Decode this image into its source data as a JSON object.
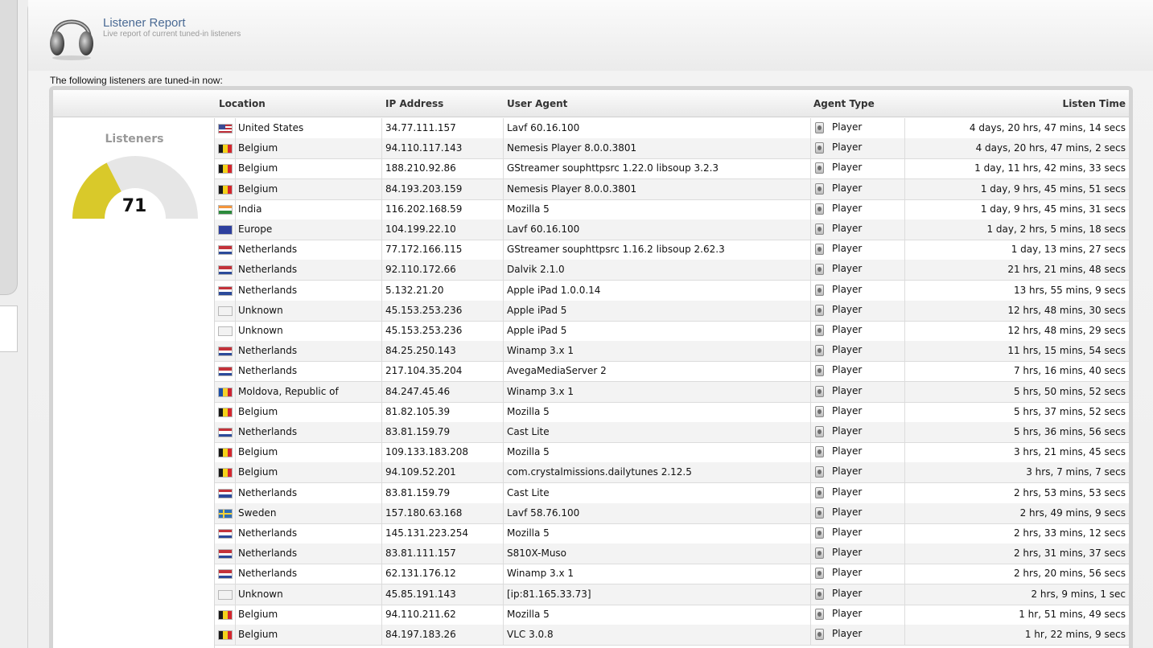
{
  "header": {
    "title": "Listener Report",
    "subtitle": "Live report of current tuned-in listeners"
  },
  "intro_text": "The following listeners are tuned-in now:",
  "table": {
    "columns": [
      "Location",
      "IP Address",
      "User Agent",
      "Agent Type",
      "Listen Time"
    ]
  },
  "summary": {
    "label": "Listeners",
    "count": "71",
    "gauge_fraction": 0.35,
    "gauge_color": "#d9c92a",
    "gauge_track_color": "#e6e6e6"
  },
  "listeners": [
    {
      "location": "United States",
      "flag": "us",
      "ip": "34.77.111.157",
      "agent": "Lavf 60.16.100",
      "type": "Player",
      "time": "4 days, 20 hrs, 47 mins, 14 secs"
    },
    {
      "location": "Belgium",
      "flag": "be",
      "ip": "94.110.117.143",
      "agent": "Nemesis Player 8.0.0.3801",
      "type": "Player",
      "time": "4 days, 20 hrs, 47 mins, 2 secs"
    },
    {
      "location": "Belgium",
      "flag": "be",
      "ip": "188.210.92.86",
      "agent": "GStreamer souphttpsrc 1.22.0 libsoup 3.2.3",
      "type": "Player",
      "time": "1 day, 11 hrs, 42 mins, 33 secs"
    },
    {
      "location": "Belgium",
      "flag": "be",
      "ip": "84.193.203.159",
      "agent": "Nemesis Player 8.0.0.3801",
      "type": "Player",
      "time": "1 day, 9 hrs, 45 mins, 51 secs"
    },
    {
      "location": "India",
      "flag": "in",
      "ip": "116.202.168.59",
      "agent": "Mozilla 5",
      "type": "Player",
      "time": "1 day, 9 hrs, 45 mins, 31 secs"
    },
    {
      "location": "Europe",
      "flag": "eu",
      "ip": "104.199.22.10",
      "agent": "Lavf 60.16.100",
      "type": "Player",
      "time": "1 day, 2 hrs, 5 mins, 18 secs"
    },
    {
      "location": "Netherlands",
      "flag": "nl",
      "ip": "77.172.166.115",
      "agent": "GStreamer souphttpsrc 1.16.2 libsoup 2.62.3",
      "type": "Player",
      "time": "1 day, 13 mins, 27 secs"
    },
    {
      "location": "Netherlands",
      "flag": "nl",
      "ip": "92.110.172.66",
      "agent": "Dalvik 2.1.0",
      "type": "Player",
      "time": "21 hrs, 21 mins, 48 secs"
    },
    {
      "location": "Netherlands",
      "flag": "nl",
      "ip": "5.132.21.20",
      "agent": "Apple iPad 1.0.0.14",
      "type": "Player",
      "time": "13 hrs, 55 mins, 9 secs"
    },
    {
      "location": "Unknown",
      "flag": "unknown",
      "ip": "45.153.253.236",
      "agent": "Apple iPad 5",
      "type": "Player",
      "time": "12 hrs, 48 mins, 30 secs"
    },
    {
      "location": "Unknown",
      "flag": "unknown",
      "ip": "45.153.253.236",
      "agent": "Apple iPad 5",
      "type": "Player",
      "time": "12 hrs, 48 mins, 29 secs"
    },
    {
      "location": "Netherlands",
      "flag": "nl",
      "ip": "84.25.250.143",
      "agent": "Winamp 3.x 1",
      "type": "Player",
      "time": "11 hrs, 15 mins, 54 secs"
    },
    {
      "location": "Netherlands",
      "flag": "nl",
      "ip": "217.104.35.204",
      "agent": "AvegaMediaServer 2",
      "type": "Player",
      "time": "7 hrs, 16 mins, 40 secs"
    },
    {
      "location": "Moldova, Republic of",
      "flag": "md",
      "ip": "84.247.45.46",
      "agent": "Winamp 3.x 1",
      "type": "Player",
      "time": "5 hrs, 50 mins, 52 secs"
    },
    {
      "location": "Belgium",
      "flag": "be",
      "ip": "81.82.105.39",
      "agent": "Mozilla 5",
      "type": "Player",
      "time": "5 hrs, 37 mins, 52 secs"
    },
    {
      "location": "Netherlands",
      "flag": "nl",
      "ip": "83.81.159.79",
      "agent": "Cast Lite",
      "type": "Player",
      "time": "5 hrs, 36 mins, 56 secs"
    },
    {
      "location": "Belgium",
      "flag": "be",
      "ip": "109.133.183.208",
      "agent": "Mozilla 5",
      "type": "Player",
      "time": "3 hrs, 21 mins, 45 secs"
    },
    {
      "location": "Belgium",
      "flag": "be",
      "ip": "94.109.52.201",
      "agent": "com.crystalmissions.dailytunes 2.12.5",
      "type": "Player",
      "time": "3 hrs, 7 mins, 7 secs"
    },
    {
      "location": "Netherlands",
      "flag": "nl",
      "ip": "83.81.159.79",
      "agent": "Cast Lite",
      "type": "Player",
      "time": "2 hrs, 53 mins, 53 secs"
    },
    {
      "location": "Sweden",
      "flag": "se",
      "ip": "157.180.63.168",
      "agent": "Lavf 58.76.100",
      "type": "Player",
      "time": "2 hrs, 49 mins, 9 secs"
    },
    {
      "location": "Netherlands",
      "flag": "nl",
      "ip": "145.131.223.254",
      "agent": "Mozilla 5",
      "type": "Player",
      "time": "2 hrs, 33 mins, 12 secs"
    },
    {
      "location": "Netherlands",
      "flag": "nl",
      "ip": "83.81.111.157",
      "agent": "S810X-Muso",
      "type": "Player",
      "time": "2 hrs, 31 mins, 37 secs"
    },
    {
      "location": "Netherlands",
      "flag": "nl",
      "ip": "62.131.176.12",
      "agent": "Winamp 3.x 1",
      "type": "Player",
      "time": "2 hrs, 20 mins, 56 secs"
    },
    {
      "location": "Unknown",
      "flag": "unknown",
      "ip": "45.85.191.143",
      "agent": "[ip:81.165.33.73]",
      "type": "Player",
      "time": "2 hrs, 9 mins, 1 sec"
    },
    {
      "location": "Belgium",
      "flag": "be",
      "ip": "94.110.211.62",
      "agent": "Mozilla 5",
      "type": "Player",
      "time": "1 hr, 51 mins, 49 secs"
    },
    {
      "location": "Belgium",
      "flag": "be",
      "ip": "84.197.183.26",
      "agent": "VLC 3.0.8",
      "type": "Player",
      "time": "1 hr, 22 mins, 9 secs"
    }
  ]
}
